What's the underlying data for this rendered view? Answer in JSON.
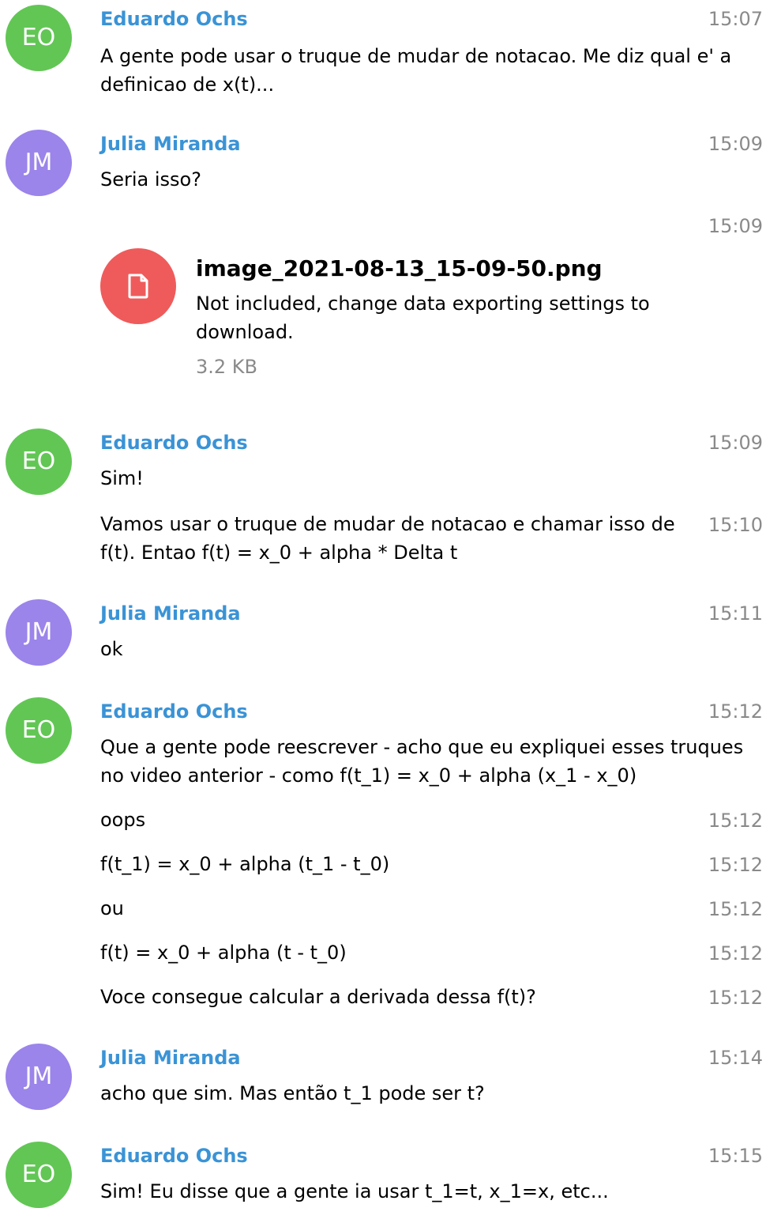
{
  "colors": {
    "avatar_eo": "#62c655",
    "avatar_jm": "#9b84ea",
    "sender_name": "#3a93d6",
    "timestamp": "#8a8a8a",
    "file_icon_bg": "#ef5b5b"
  },
  "messages": [
    {
      "initials": "EO",
      "sender": "Eduardo Ochs",
      "time": "15:07",
      "text": "A gente pode usar o truque de mudar de notacao. Me diz qual e' a definicao de x(t)..."
    },
    {
      "initials": "JM",
      "sender": "Julia Miranda",
      "time": "15:09",
      "text": "Seria isso?"
    },
    {
      "time": "15:09",
      "file": {
        "icon": "document-icon",
        "name": "image_2021-08-13_15-09-50.png",
        "note": "Not included, change data exporting settings to download.",
        "size": "3.2 KB"
      }
    },
    {
      "initials": "EO",
      "sender": "Eduardo Ochs",
      "time": "15:09",
      "text": "Sim!"
    },
    {
      "time": "15:10",
      "text": "Vamos usar o truque de mudar de notacao e chamar isso de f(t). Entao f(t) = x_0 + alpha * Delta t"
    },
    {
      "initials": "JM",
      "sender": "Julia Miranda",
      "time": "15:11",
      "text": "ok"
    },
    {
      "initials": "EO",
      "sender": "Eduardo Ochs",
      "time": "15:12",
      "text": "Que a gente pode reescrever - acho que eu expliquei esses truques no video anterior - como f(t_1) = x_0 + alpha (x_1 - x_0)"
    },
    {
      "time": "15:12",
      "text": "oops"
    },
    {
      "time": "15:12",
      "text": "f(t_1) = x_0 + alpha (t_1 - t_0)"
    },
    {
      "time": "15:12",
      "text": "ou"
    },
    {
      "time": "15:12",
      "text": "f(t) = x_0 + alpha (t - t_0)"
    },
    {
      "time": "15:12",
      "text": "Voce consegue calcular a derivada dessa f(t)?"
    },
    {
      "initials": "JM",
      "sender": "Julia Miranda",
      "time": "15:14",
      "text": "acho que sim. Mas então t_1 pode ser t?"
    },
    {
      "initials": "EO",
      "sender": "Eduardo Ochs",
      "time": "15:15",
      "text": "Sim! Eu disse que a gente ia usar t_1=t, x_1=x, etc..."
    }
  ]
}
